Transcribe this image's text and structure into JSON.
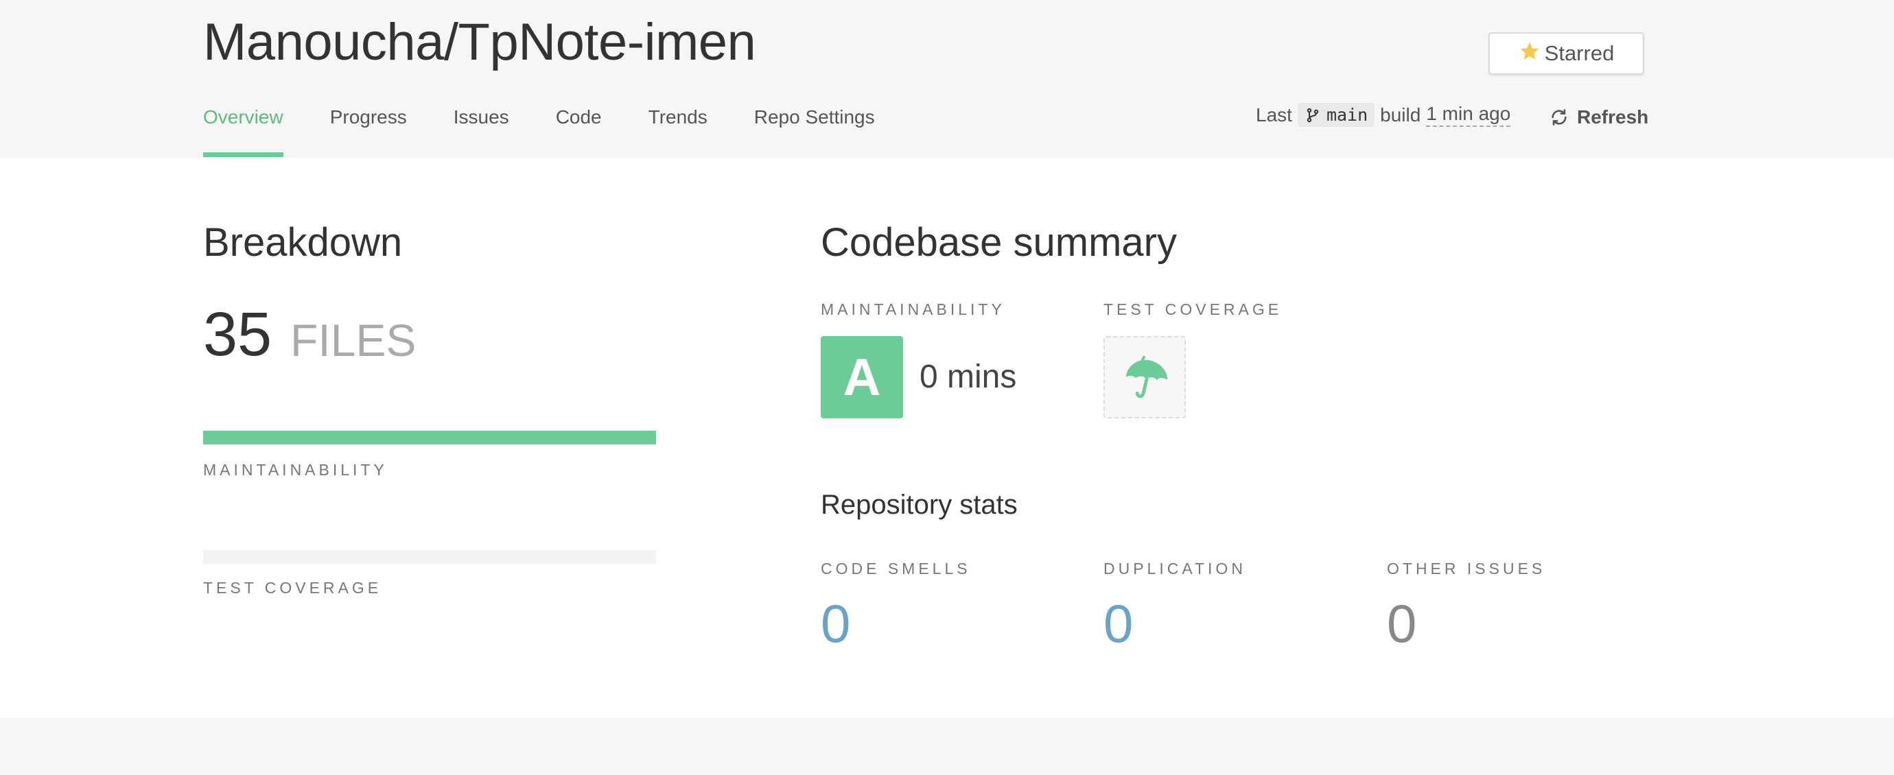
{
  "header": {
    "repo_title": "Manoucha/TpNote-imen",
    "star_button_label": "Starred",
    "tabs": [
      {
        "label": "Overview",
        "active": true
      },
      {
        "label": "Progress",
        "active": false
      },
      {
        "label": "Issues",
        "active": false
      },
      {
        "label": "Code",
        "active": false
      },
      {
        "label": "Trends",
        "active": false
      },
      {
        "label": "Repo Settings",
        "active": false
      }
    ],
    "build": {
      "prefix": "Last",
      "branch": "main",
      "middle": "build",
      "time_ago": "1 min ago"
    },
    "refresh_label": "Refresh"
  },
  "breakdown": {
    "title": "Breakdown",
    "files_count": "35",
    "files_label": "FILES",
    "maintainability_label": "MAINTAINABILITY",
    "maintainability_fraction": 1.0,
    "test_coverage_label": "TEST COVERAGE",
    "test_coverage_fraction": 0.0
  },
  "summary": {
    "title": "Codebase summary",
    "maintainability_label": "MAINTAINABILITY",
    "grade": "A",
    "tech_debt": "0 mins",
    "test_coverage_label": "TEST COVERAGE",
    "coverage_icon": "umbrella-icon"
  },
  "stats": {
    "title": "Repository stats",
    "items": [
      {
        "label": "CODE SMELLS",
        "value": "0",
        "color": "#6aa3c7"
      },
      {
        "label": "DUPLICATION",
        "value": "0",
        "color": "#6aa3c7"
      },
      {
        "label": "OTHER ISSUES",
        "value": "0",
        "color": "#888888"
      }
    ]
  },
  "colors": {
    "accent_green": "#6ccb96",
    "active_tab": "#5cba7d",
    "star": "#f2c94c"
  }
}
